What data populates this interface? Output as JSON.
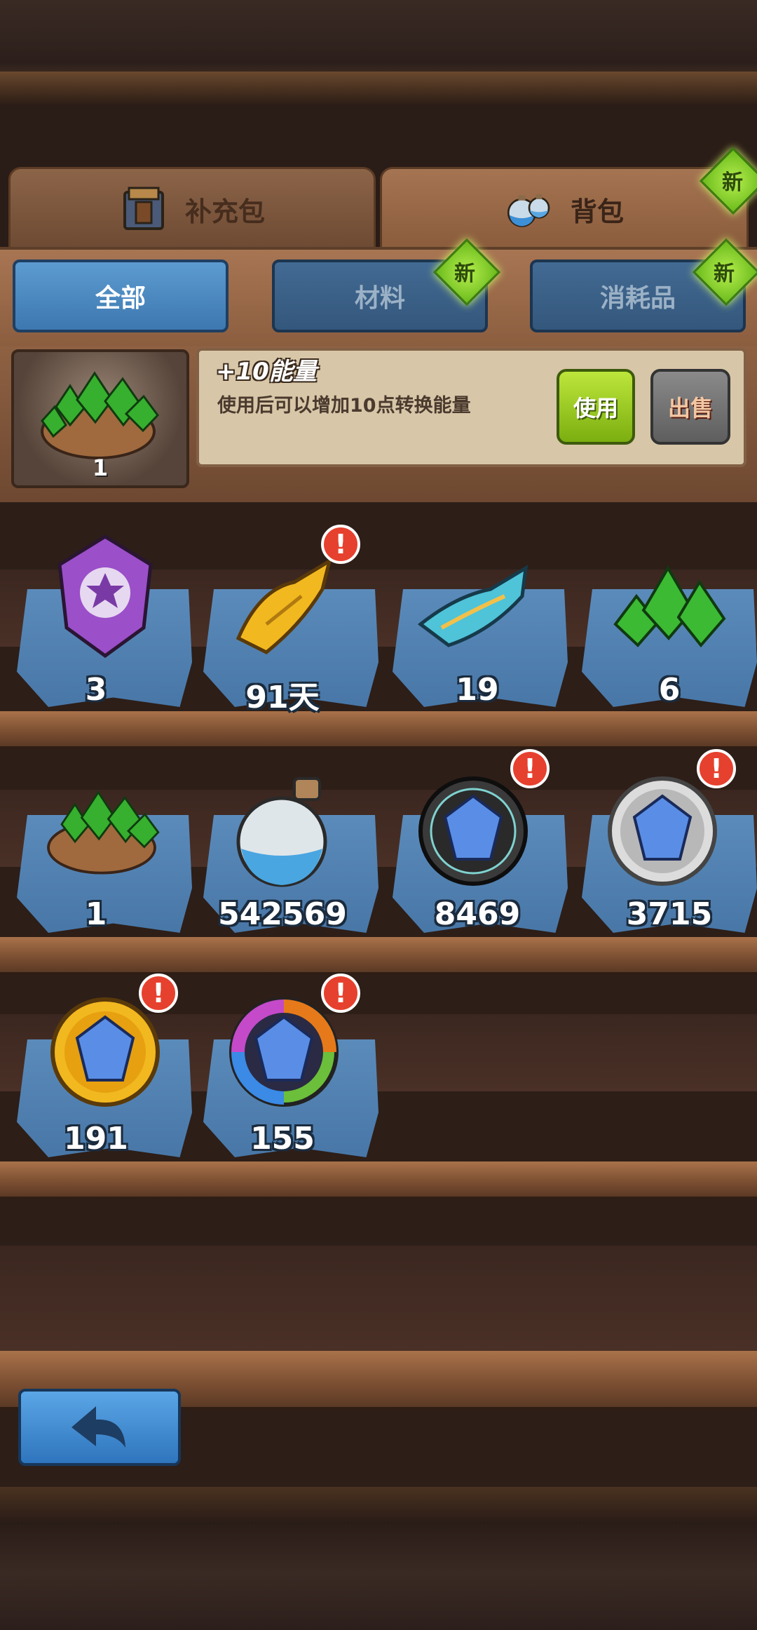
{
  "tabs": [
    {
      "label": "补充包",
      "active": false,
      "icon": "card-box-icon"
    },
    {
      "label": "背包",
      "active": true,
      "icon": "potion-bottles-icon",
      "badge": "新"
    }
  ],
  "subtabs": [
    {
      "label": "全部",
      "active": true
    },
    {
      "label": "材料",
      "active": false,
      "badge": "新"
    },
    {
      "label": "消耗品",
      "active": false,
      "badge": "新"
    }
  ],
  "detail": {
    "count": "1",
    "title": "+10能量",
    "description": "使用后可以增加10点转换能量",
    "use_label": "使用",
    "sell_label": "出售"
  },
  "items": [
    {
      "count": "3",
      "icon": "purple-star-gem-icon",
      "alert": false
    },
    {
      "count": "91天",
      "icon": "gold-scroll-icon",
      "alert": true
    },
    {
      "count": "19",
      "icon": "blue-scroll-icon",
      "alert": false
    },
    {
      "count": "6",
      "icon": "green-crystals-icon",
      "alert": false
    },
    {
      "count": "1",
      "icon": "crystal-sack-icon",
      "alert": false
    },
    {
      "count": "542569",
      "icon": "blue-sand-bottle-icon",
      "alert": false
    },
    {
      "count": "8469",
      "icon": "dark-crystal-medal-icon",
      "alert": true
    },
    {
      "count": "3715",
      "icon": "silver-crystal-medal-icon",
      "alert": true
    },
    {
      "count": "191",
      "icon": "gold-crystal-medal-icon",
      "alert": true
    },
    {
      "count": "155",
      "icon": "rainbow-crystal-medal-icon",
      "alert": true
    }
  ],
  "colors": {
    "active_subtab": "#4a88c2",
    "new_badge": "#8fd12a",
    "alert": "#e6412e",
    "use_button": "#9ccb22"
  }
}
